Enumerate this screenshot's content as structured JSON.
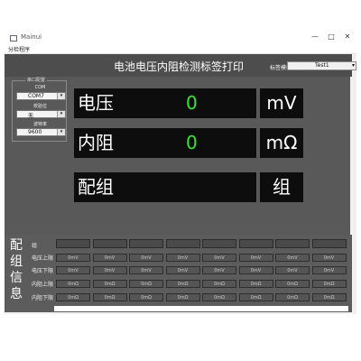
{
  "window": {
    "title": "Mainui",
    "controls": {
      "minimize": "—",
      "maximize": "□",
      "close": "✕"
    }
  },
  "menu": {
    "items": [
      "分检程序"
    ]
  },
  "header": {
    "title": "电池电压内阻检测标签打印",
    "template_label": "标签模板",
    "template_value": "Test1"
  },
  "side": {
    "group_label": "串口配置",
    "fields": [
      {
        "label": "COM",
        "value": "COM7"
      },
      {
        "label": "校验位",
        "value": "无"
      },
      {
        "label": "波特率",
        "value": "9600"
      }
    ]
  },
  "readings": {
    "voltage": {
      "label": "电压",
      "value": "0",
      "unit": "mV"
    },
    "resistance": {
      "label": "内阻",
      "value": "0",
      "unit": "mΩ"
    },
    "group": {
      "label": "配组",
      "value": "",
      "unit": "组"
    }
  },
  "grouping": {
    "section_title": [
      "配",
      "组",
      "信",
      "息"
    ],
    "row_labels": [
      "组",
      "电压上限",
      "电压下限",
      "内阻上限",
      "内阻下限"
    ],
    "columns": 8,
    "rows": [
      {
        "values": [
          "0mV",
          "0mV",
          "0mV",
          "0mV",
          "0mV",
          "0mV",
          "0mV",
          "0mV"
        ]
      },
      {
        "values": [
          "0mV",
          "0mV",
          "0mV",
          "0mV",
          "0mV",
          "0mV",
          "0mV",
          "0mV"
        ]
      },
      {
        "values": [
          "0mΩ",
          "0mΩ",
          "0mΩ",
          "0mΩ",
          "0mΩ",
          "0mΩ",
          "0mΩ",
          "0mΩ"
        ]
      },
      {
        "values": [
          "0mΩ",
          "0mΩ",
          "0mΩ",
          "0mΩ",
          "0mΩ",
          "0mΩ",
          "0mΩ",
          "0mΩ"
        ]
      }
    ]
  },
  "colors": {
    "value_green": "#35e535",
    "panel": "#595959",
    "display": "#0d0d0d"
  }
}
